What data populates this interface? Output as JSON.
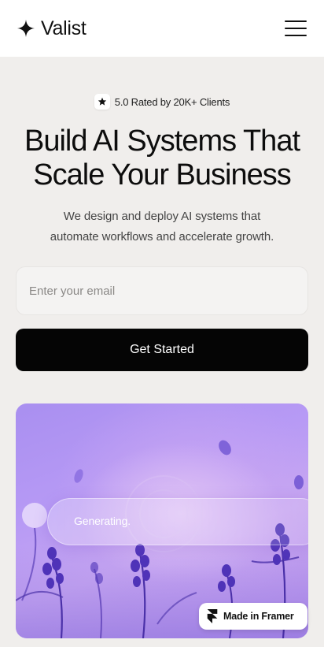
{
  "header": {
    "brand_name": "Valist",
    "brand_icon": "sparkle-icon",
    "menu_icon": "hamburger-menu-icon"
  },
  "hero": {
    "rating_icon": "star-icon",
    "rating_text": "5.0 Rated by 20K+ Clients",
    "title_line1": "Build AI Systems That",
    "title_line2": "Scale Your Business",
    "subtitle_line1": "We design and deploy AI systems that",
    "subtitle_line2": "automate workflows and accelerate growth."
  },
  "form": {
    "email_placeholder": "Enter your email",
    "email_value": "",
    "cta_label": "Get Started"
  },
  "visual": {
    "status_text": "Generating.",
    "accent_color": "#b79af5"
  },
  "badge": {
    "icon": "framer-logo-icon",
    "label": "Made in Framer"
  }
}
